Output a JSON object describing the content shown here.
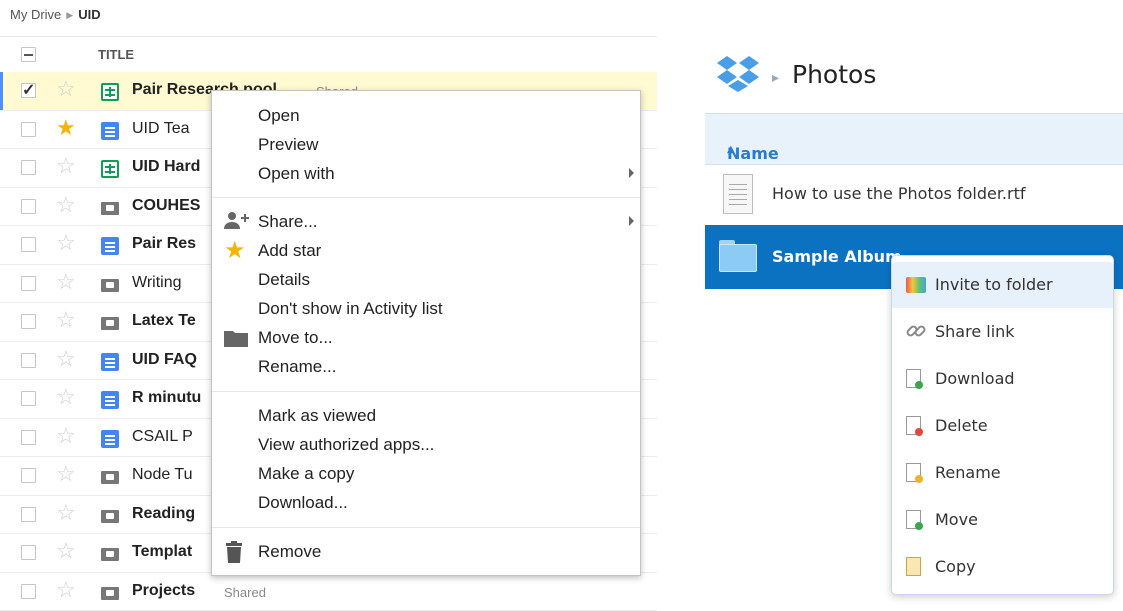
{
  "drive": {
    "breadcrumb": {
      "root": "My Drive",
      "current": "UID"
    },
    "header": {
      "title": "TITLE"
    },
    "files": [
      {
        "name": "Pair Research pool",
        "type": "sheet",
        "bold": true,
        "starred": false,
        "checked": true,
        "shared": "Shared"
      },
      {
        "name": "UID Tea",
        "type": "doc",
        "bold": false,
        "starred": true,
        "checked": false,
        "shared": ""
      },
      {
        "name": "UID Hard",
        "type": "sheet",
        "bold": true,
        "starred": false,
        "checked": false,
        "shared": ""
      },
      {
        "name": "COUHES",
        "type": "folder",
        "bold": true,
        "starred": false,
        "checked": false,
        "shared": ""
      },
      {
        "name": "Pair Res",
        "type": "doc",
        "bold": true,
        "starred": false,
        "checked": false,
        "shared": ""
      },
      {
        "name": "Writing",
        "type": "folder",
        "bold": false,
        "starred": false,
        "checked": false,
        "shared": ""
      },
      {
        "name": "Latex Te",
        "type": "folder",
        "bold": true,
        "starred": false,
        "checked": false,
        "shared": ""
      },
      {
        "name": "UID FAQ",
        "type": "doc",
        "bold": true,
        "starred": false,
        "checked": false,
        "shared": ""
      },
      {
        "name": "R minutu",
        "type": "doc",
        "bold": true,
        "starred": false,
        "checked": false,
        "shared": ""
      },
      {
        "name": "CSAIL P",
        "type": "doc",
        "bold": false,
        "starred": false,
        "checked": false,
        "shared": ""
      },
      {
        "name": "Node Tu",
        "type": "folder",
        "bold": false,
        "starred": false,
        "checked": false,
        "shared": ""
      },
      {
        "name": "Reading",
        "type": "folder",
        "bold": true,
        "starred": false,
        "checked": false,
        "shared": ""
      },
      {
        "name": "Templat",
        "type": "folder",
        "bold": true,
        "starred": false,
        "checked": false,
        "shared": ""
      },
      {
        "name": "Projects",
        "type": "folder",
        "bold": true,
        "starred": false,
        "checked": false,
        "shared": "Shared"
      }
    ],
    "context_menu": {
      "open": "Open",
      "preview": "Preview",
      "open_with": "Open with",
      "share": "Share...",
      "add_star": "Add star",
      "details": "Details",
      "dont_show": "Don't show in Activity list",
      "move_to": "Move to...",
      "rename": "Rename...",
      "mark_viewed": "Mark as viewed",
      "view_apps": "View authorized apps...",
      "make_copy": "Make a copy",
      "download": "Download...",
      "remove": "Remove"
    }
  },
  "dropbox": {
    "title": "Photos",
    "column_name": "Name",
    "sort_indicator": "▲",
    "files": [
      {
        "name": "How to use the Photos folder.rtf",
        "icon": "rtf-file-icon"
      },
      {
        "name": "Sample Album",
        "icon": "folder-icon",
        "selected": true
      }
    ],
    "context_menu": [
      {
        "label": "Invite to folder",
        "icon": "invite-icon"
      },
      {
        "label": "Share link",
        "icon": "link-icon"
      },
      {
        "label": "Download",
        "icon": "download-icon"
      },
      {
        "label": "Delete",
        "icon": "delete-icon"
      },
      {
        "label": "Rename",
        "icon": "rename-icon"
      },
      {
        "label": "Move",
        "icon": "move-icon"
      },
      {
        "label": "Copy",
        "icon": "copy-icon"
      }
    ],
    "accent": "#0b72c2"
  }
}
